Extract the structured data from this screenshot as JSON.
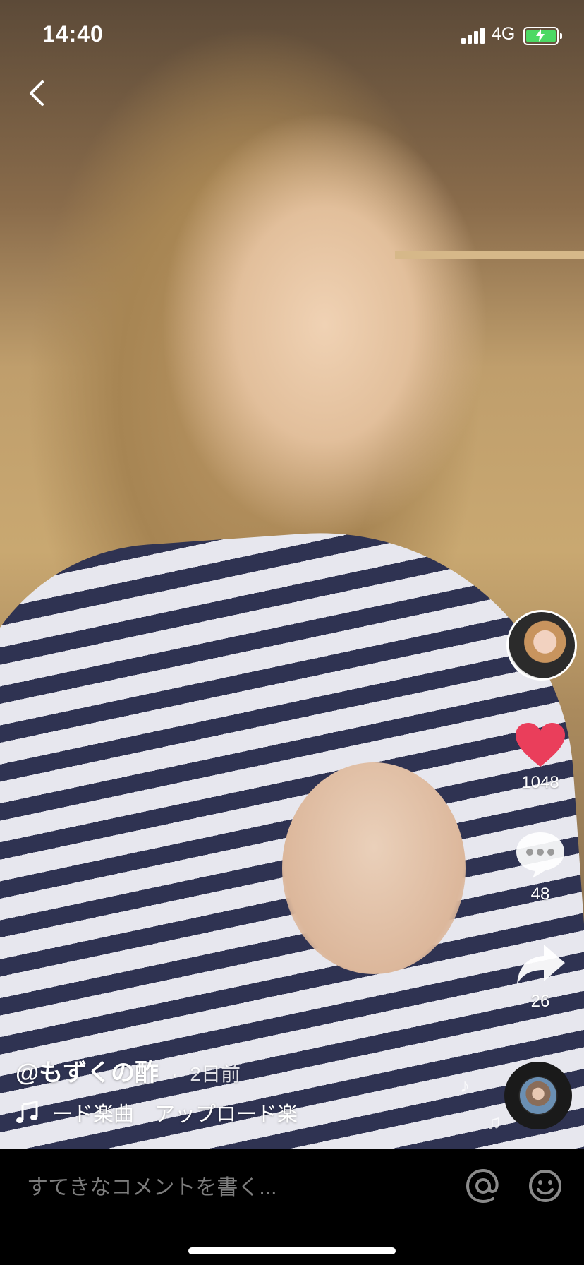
{
  "status_bar": {
    "time": "14:40",
    "network": "4G",
    "battery_color": "#4cd964"
  },
  "icons": {
    "back": "chevron-left-icon",
    "avatar": "creator-avatar",
    "like": "heart-icon",
    "comment": "comment-bubble-icon",
    "share": "share-arrow-icon",
    "music": "music-note-icon",
    "mention": "at-sign-icon",
    "emoji": "smiley-icon"
  },
  "sidebar": {
    "likes": "1048",
    "comments": "48",
    "shares": "26",
    "like_color": "#ea3e5b"
  },
  "video_info": {
    "author": "@もずくの酢",
    "separator": "·",
    "posted": "2日前",
    "music": "ード楽曲　アップロード楽"
  },
  "comment_bar": {
    "placeholder": "すてきなコメントを書く..."
  }
}
